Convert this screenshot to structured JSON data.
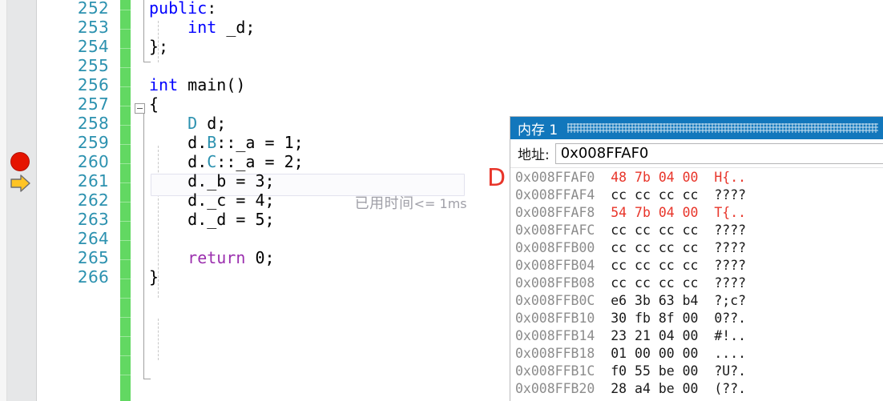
{
  "editor": {
    "first_line_number": 252,
    "lines": [
      {
        "number": "252",
        "indent": 0,
        "tokens": [
          {
            "t": "public",
            "c": "kw"
          },
          {
            "t": ":",
            "c": ""
          }
        ]
      },
      {
        "number": "253",
        "indent": 0,
        "tokens": [
          {
            "t": "    ",
            "c": ""
          },
          {
            "t": "int",
            "c": "kw"
          },
          {
            "t": " _d;",
            "c": ""
          }
        ]
      },
      {
        "number": "254",
        "indent": 0,
        "tokens": [
          {
            "t": "};",
            "c": ""
          }
        ]
      },
      {
        "number": "255",
        "indent": 0,
        "tokens": []
      },
      {
        "number": "256",
        "indent": 0,
        "tokens": [
          {
            "t": "int",
            "c": "kw"
          },
          {
            "t": " ",
            "c": ""
          },
          {
            "t": "main",
            "c": ""
          },
          {
            "t": "()",
            "c": ""
          }
        ]
      },
      {
        "number": "257",
        "indent": 0,
        "tokens": [
          {
            "t": "{",
            "c": ""
          }
        ]
      },
      {
        "number": "258",
        "indent": 0,
        "tokens": [
          {
            "t": "    ",
            "c": ""
          },
          {
            "t": "D",
            "c": "type"
          },
          {
            "t": " d;",
            "c": ""
          }
        ]
      },
      {
        "number": "259",
        "indent": 0,
        "tokens": [
          {
            "t": "    d.",
            "c": ""
          },
          {
            "t": "B",
            "c": "type"
          },
          {
            "t": "::_a = ",
            "c": ""
          },
          {
            "t": "1",
            "c": "num"
          },
          {
            "t": ";",
            "c": ""
          }
        ]
      },
      {
        "number": "260",
        "indent": 0,
        "tokens": [
          {
            "t": "    d.",
            "c": ""
          },
          {
            "t": "C",
            "c": "type"
          },
          {
            "t": "::_a = ",
            "c": ""
          },
          {
            "t": "2",
            "c": "num"
          },
          {
            "t": ";",
            "c": ""
          }
        ]
      },
      {
        "number": "261",
        "indent": 0,
        "tokens": [
          {
            "t": "    d._b = ",
            "c": ""
          },
          {
            "t": "3",
            "c": "num"
          },
          {
            "t": ";",
            "c": ""
          }
        ]
      },
      {
        "number": "262",
        "indent": 0,
        "tokens": [
          {
            "t": "    d._c = ",
            "c": ""
          },
          {
            "t": "4",
            "c": "num"
          },
          {
            "t": ";",
            "c": ""
          }
        ]
      },
      {
        "number": "263",
        "indent": 0,
        "tokens": [
          {
            "t": "    d._d = ",
            "c": ""
          },
          {
            "t": "5",
            "c": "num"
          },
          {
            "t": ";",
            "c": ""
          }
        ]
      },
      {
        "number": "264",
        "indent": 0,
        "tokens": []
      },
      {
        "number": "265",
        "indent": 0,
        "tokens": [
          {
            "t": "    ",
            "c": ""
          },
          {
            "t": "return",
            "c": "kw-ctrl"
          },
          {
            "t": " ",
            "c": ""
          },
          {
            "t": "0",
            "c": "num"
          },
          {
            "t": ";",
            "c": ""
          }
        ]
      },
      {
        "number": "266",
        "indent": 0,
        "tokens": [
          {
            "t": "}",
            "c": ""
          }
        ]
      }
    ],
    "gutter": {
      "breakpoint_line": "258",
      "breakpoint_icon": "breakpoint-dot-icon",
      "execution_line": "259",
      "execution_icon": "execution-arrow-icon"
    },
    "outlining": {
      "collapse_toggle_line": "256",
      "collapse_icon": "collapse-minus-icon"
    },
    "current_statement_line": "259",
    "perftip": {
      "label": "已用时间",
      "value": "<= 1ms"
    },
    "datatip_letter": "D",
    "colors": {
      "line_number": "#2b91af",
      "keyword": "#0000ff",
      "control_keyword": "#9b2fae",
      "type": "#2b91af",
      "change_bar": "#62d862",
      "breakpoint": "#e51400",
      "execution_arrow": "#ffc425",
      "datatip": "#e8352a"
    }
  },
  "memory_window": {
    "title": "内存 1",
    "address_label": "地址:",
    "address_value": "0x008FFAF0",
    "address_placeholder": "0x008FFAF0",
    "accent_color": "#1277bc",
    "changed_color": "#e8352a",
    "rows": [
      {
        "address": "0x008FFAF0",
        "bytes": "48 7b 04 00",
        "ascii": "H{..",
        "changed": true
      },
      {
        "address": "0x008FFAF4",
        "bytes": "cc cc cc cc",
        "ascii": "????",
        "changed": false
      },
      {
        "address": "0x008FFAF8",
        "bytes": "54 7b 04 00",
        "ascii": "T{..",
        "changed": true
      },
      {
        "address": "0x008FFAFC",
        "bytes": "cc cc cc cc",
        "ascii": "????",
        "changed": false
      },
      {
        "address": "0x008FFB00",
        "bytes": "cc cc cc cc",
        "ascii": "????",
        "changed": false
      },
      {
        "address": "0x008FFB04",
        "bytes": "cc cc cc cc",
        "ascii": "????",
        "changed": false
      },
      {
        "address": "0x008FFB08",
        "bytes": "cc cc cc cc",
        "ascii": "????",
        "changed": false
      },
      {
        "address": "0x008FFB0C",
        "bytes": "e6 3b 63 b4",
        "ascii": "?;c?",
        "changed": false
      },
      {
        "address": "0x008FFB10",
        "bytes": "30 fb 8f 00",
        "ascii": "0??.",
        "changed": false
      },
      {
        "address": "0x008FFB14",
        "bytes": "23 21 04 00",
        "ascii": "#!..",
        "changed": false
      },
      {
        "address": "0x008FFB18",
        "bytes": "01 00 00 00",
        "ascii": "....",
        "changed": false
      },
      {
        "address": "0x008FFB1C",
        "bytes": "f0 55 be 00",
        "ascii": "?U?.",
        "changed": false
      },
      {
        "address": "0x008FFB20",
        "bytes": "28 a4 be 00",
        "ascii": "(??.",
        "changed": false
      }
    ]
  }
}
